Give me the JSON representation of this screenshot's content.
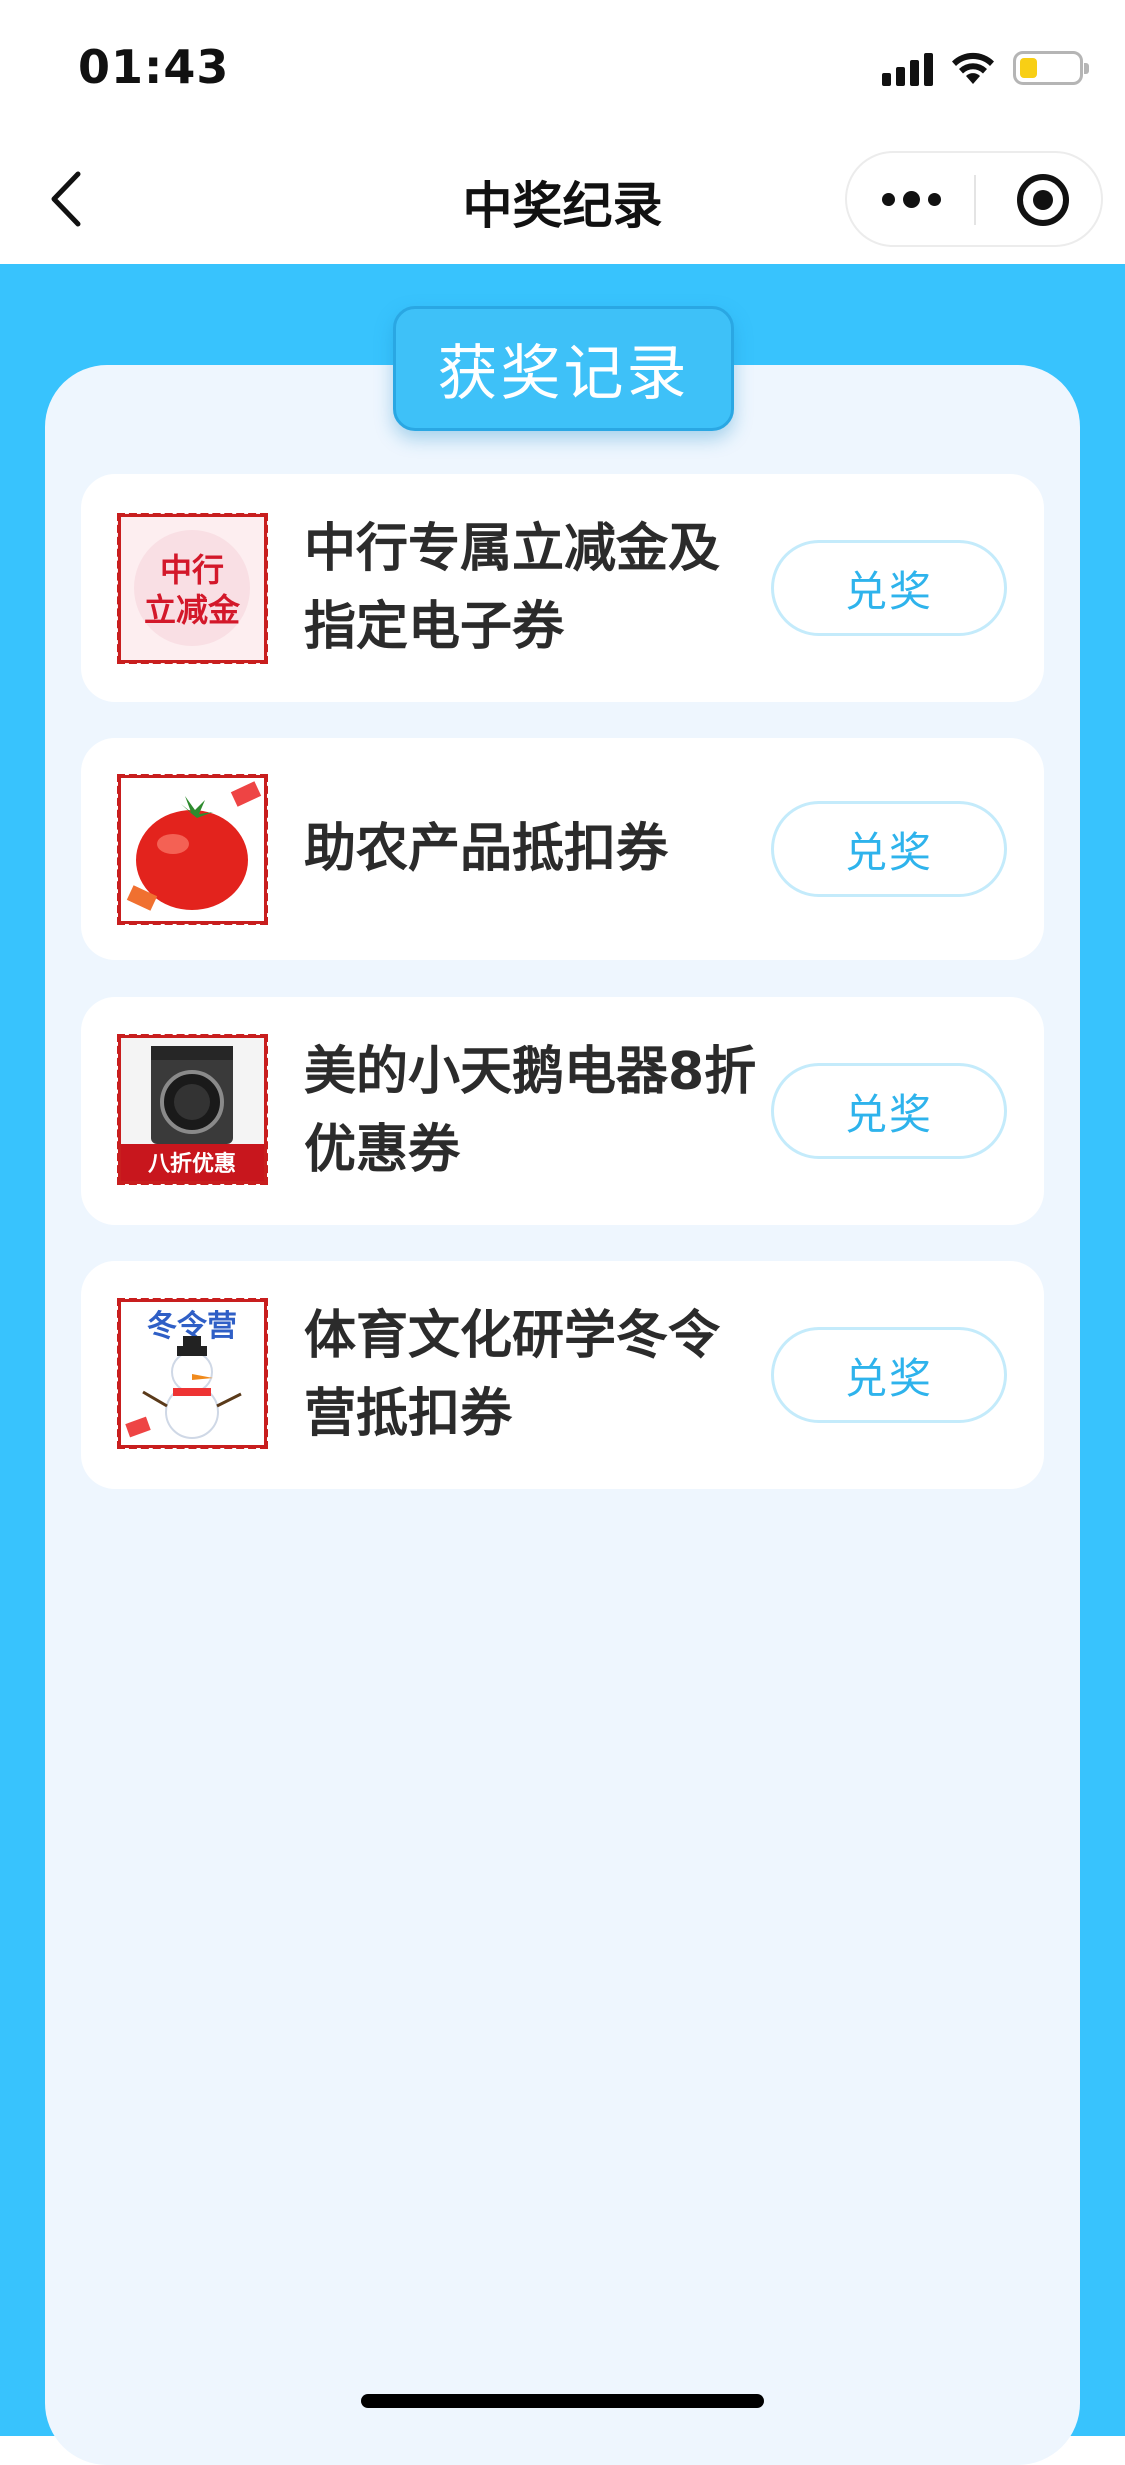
{
  "status_bar": {
    "time": "01:43",
    "icons": [
      "signal-icon",
      "wifi-icon",
      "battery-icon"
    ],
    "battery_level": 0.3
  },
  "nav": {
    "title": "中奖纪录",
    "back_icon": "chevron-left-icon",
    "more_icon": "more-dots-icon",
    "close_icon": "target-circle-icon"
  },
  "panel": {
    "tab_label": "获奖记录"
  },
  "prizes": [
    {
      "name_line1": "中行专属立减金及",
      "name_line2": "指定电子券",
      "thumb_text_line1": "中行",
      "thumb_text_line2": "立减金",
      "button_label": "兑奖"
    },
    {
      "name_line1": "助农产品抵扣券",
      "name_line2": "",
      "thumb_icon": "tomato-icon",
      "button_label": "兑奖"
    },
    {
      "name_line1": "美的小天鹅电器8折",
      "name_line2": "优惠券",
      "thumb_text": "八折优惠",
      "thumb_icon": "washing-machine-icon",
      "button_label": "兑奖"
    },
    {
      "name_line1": "体育文化研学冬令",
      "name_line2": "营抵扣券",
      "thumb_text": "冬令营",
      "thumb_icon": "snowman-icon",
      "button_label": "兑奖"
    }
  ],
  "colors": {
    "page_blue": "#38c3fd",
    "panel_bg": "#eef6fe",
    "tab_blue": "#3ec1f8",
    "button_text": "#2eb3ec",
    "thumb_border": "#c81e1e"
  }
}
